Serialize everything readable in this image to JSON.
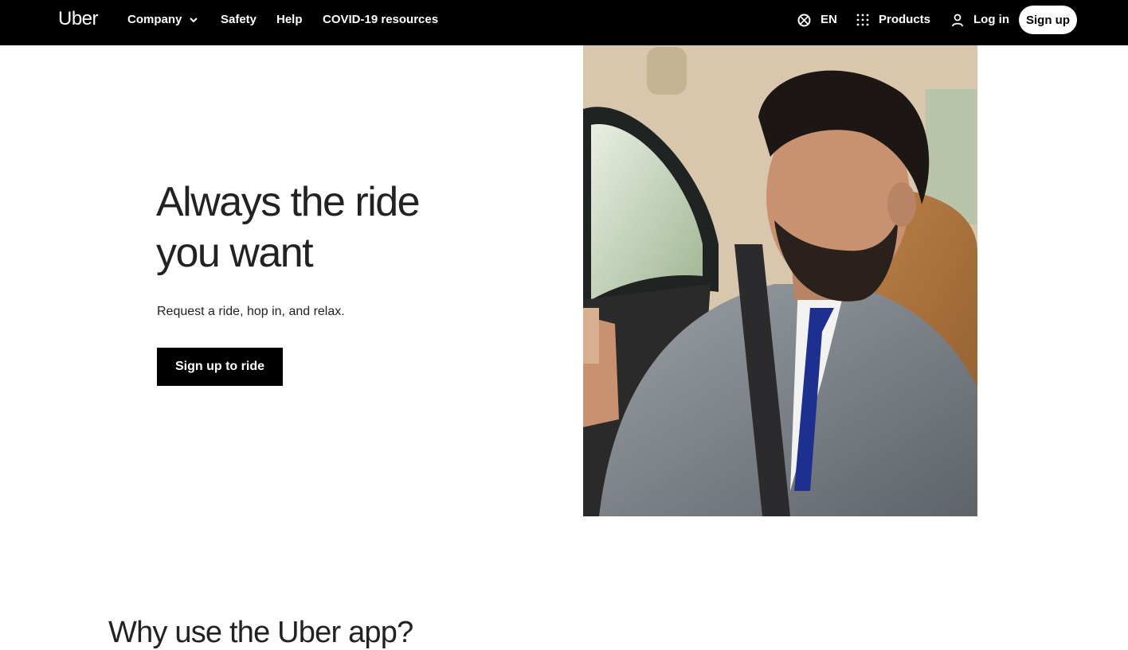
{
  "header": {
    "logo": "Uber",
    "nav": {
      "company": "Company",
      "safety": "Safety",
      "help": "Help",
      "covid": "COVID-19 resources"
    },
    "language": "EN",
    "products": "Products",
    "login": "Log in",
    "signup": "Sign up"
  },
  "hero": {
    "title_line1": "Always the ride",
    "title_line2": "you want",
    "subtitle": "Request a ride, hop in, and relax.",
    "cta": "Sign up to ride",
    "image_alt": "man-in-car-looking-at-phone"
  },
  "why": {
    "title": "Why use the Uber app?"
  },
  "colors": {
    "header_bg": "#000000",
    "page_bg": "#ffffff",
    "button_bg": "#000000",
    "text": "#222222"
  },
  "icons": {
    "company_dropdown": "chevron-down-icon",
    "language": "globe-icon",
    "products": "grid-icon",
    "login": "user-icon"
  }
}
